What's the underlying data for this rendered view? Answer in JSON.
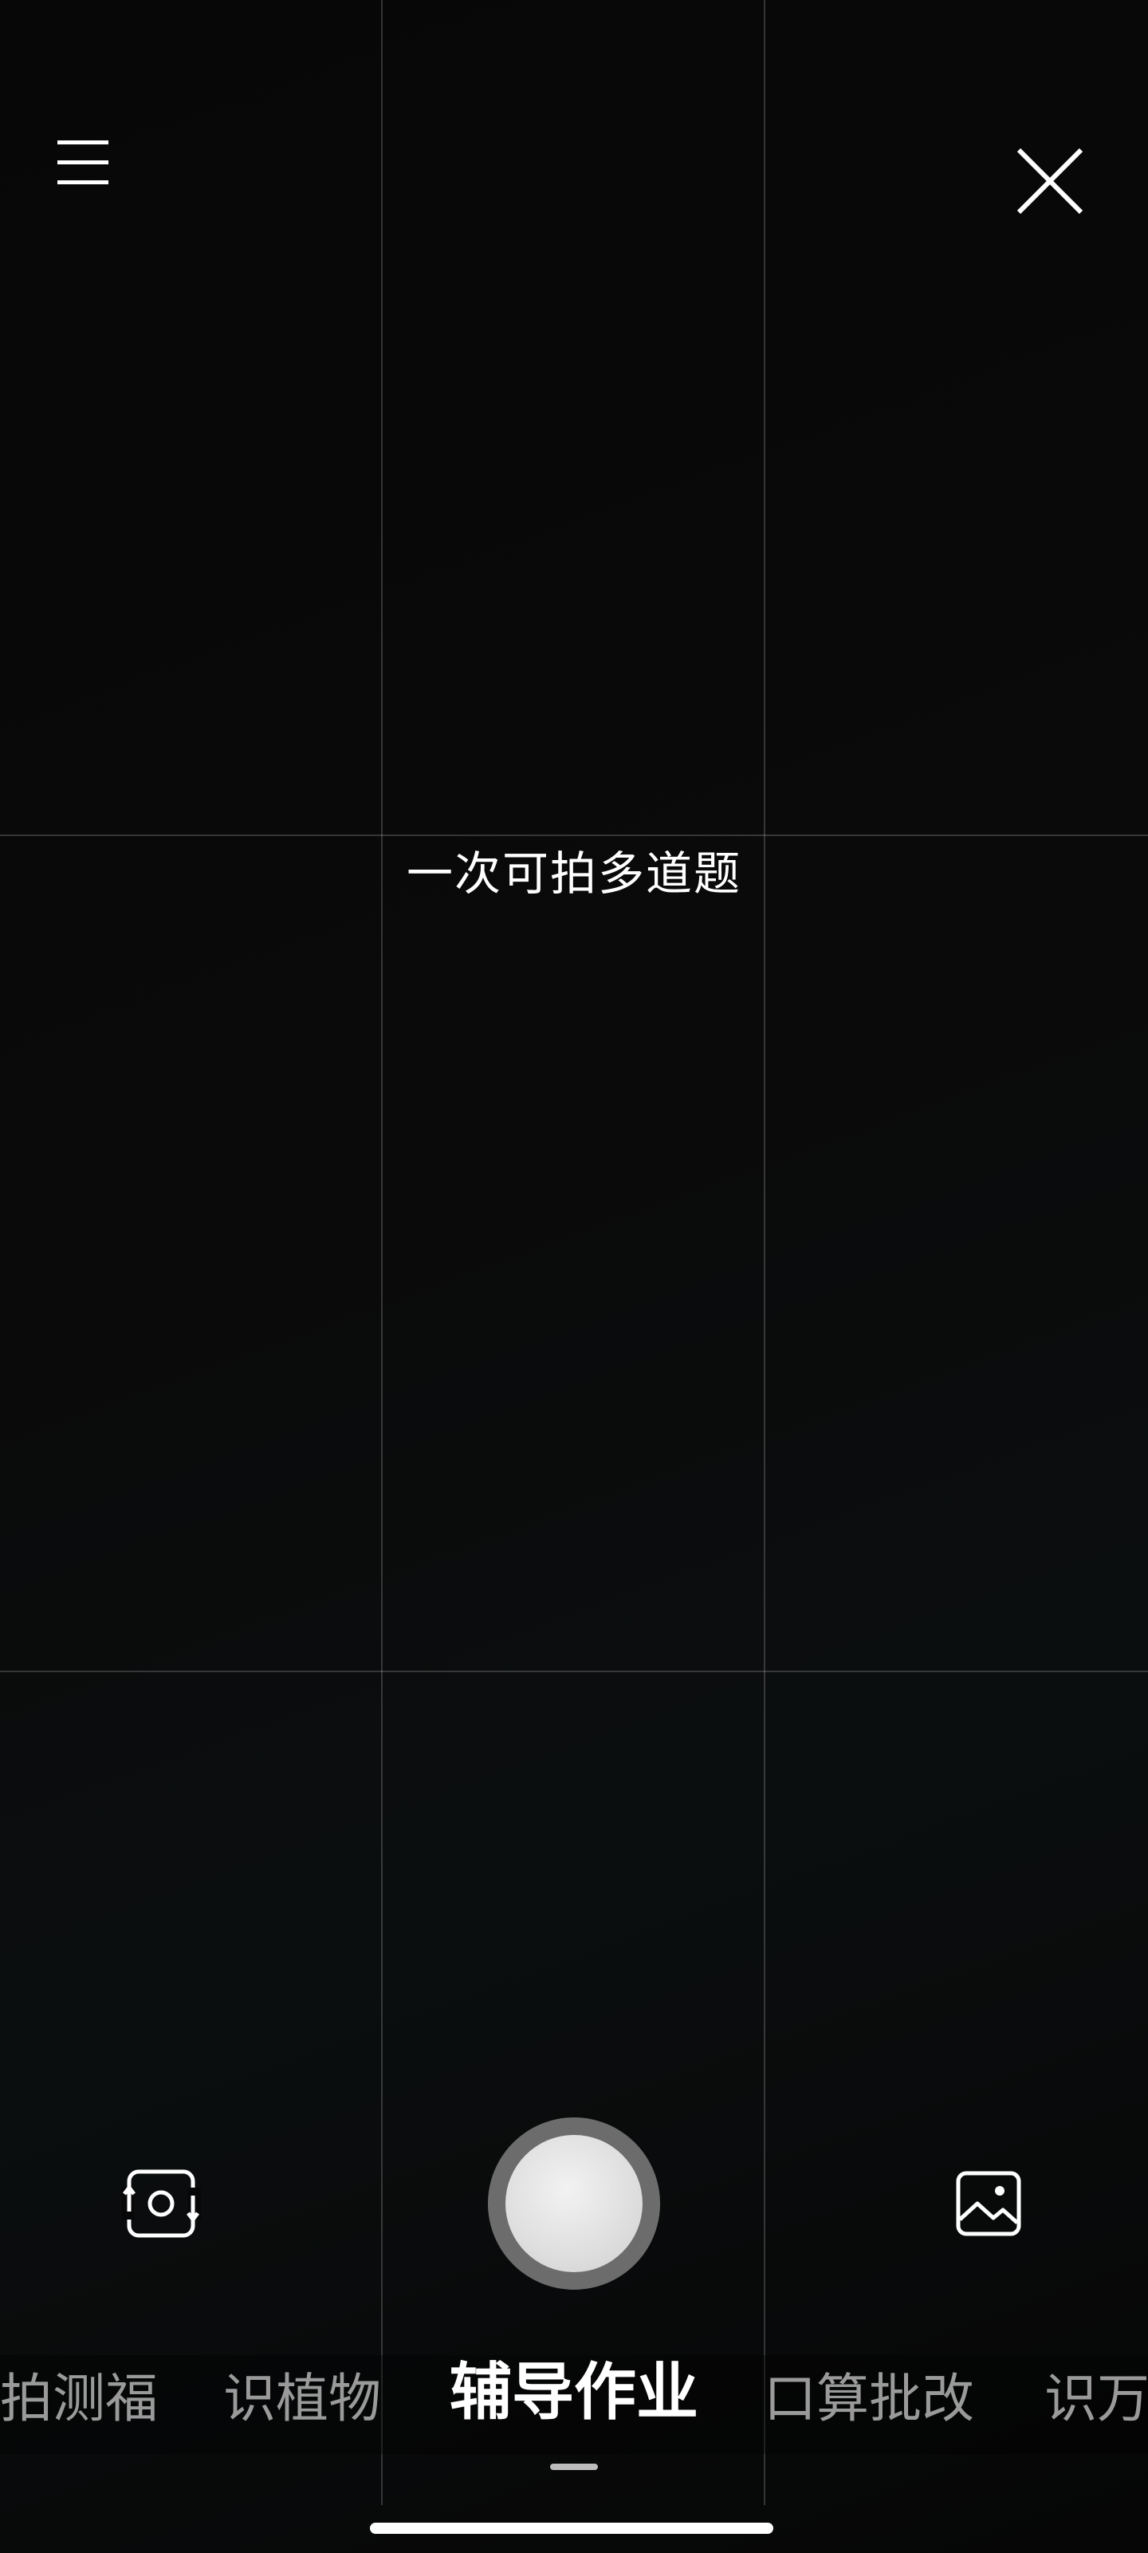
{
  "hint": "一次可拍多道题",
  "icons": {
    "menu": "menu-icon",
    "close": "close-icon",
    "flip_camera": "camera-flip-icon",
    "shutter": "shutter-button",
    "gallery": "gallery-icon"
  },
  "modes": [
    {
      "label": "拍测福"
    },
    {
      "label": "识植物"
    },
    {
      "label": "辅导作业"
    },
    {
      "label": "口算批改"
    },
    {
      "label": "识万"
    }
  ],
  "active_mode": "辅导作业",
  "colors": {
    "background": "#050505",
    "text_primary": "#ffffff",
    "text_inactive": "#9a9a9a",
    "shutter_ring": "#6c6c6c",
    "shutter_fill": "#dedede"
  }
}
